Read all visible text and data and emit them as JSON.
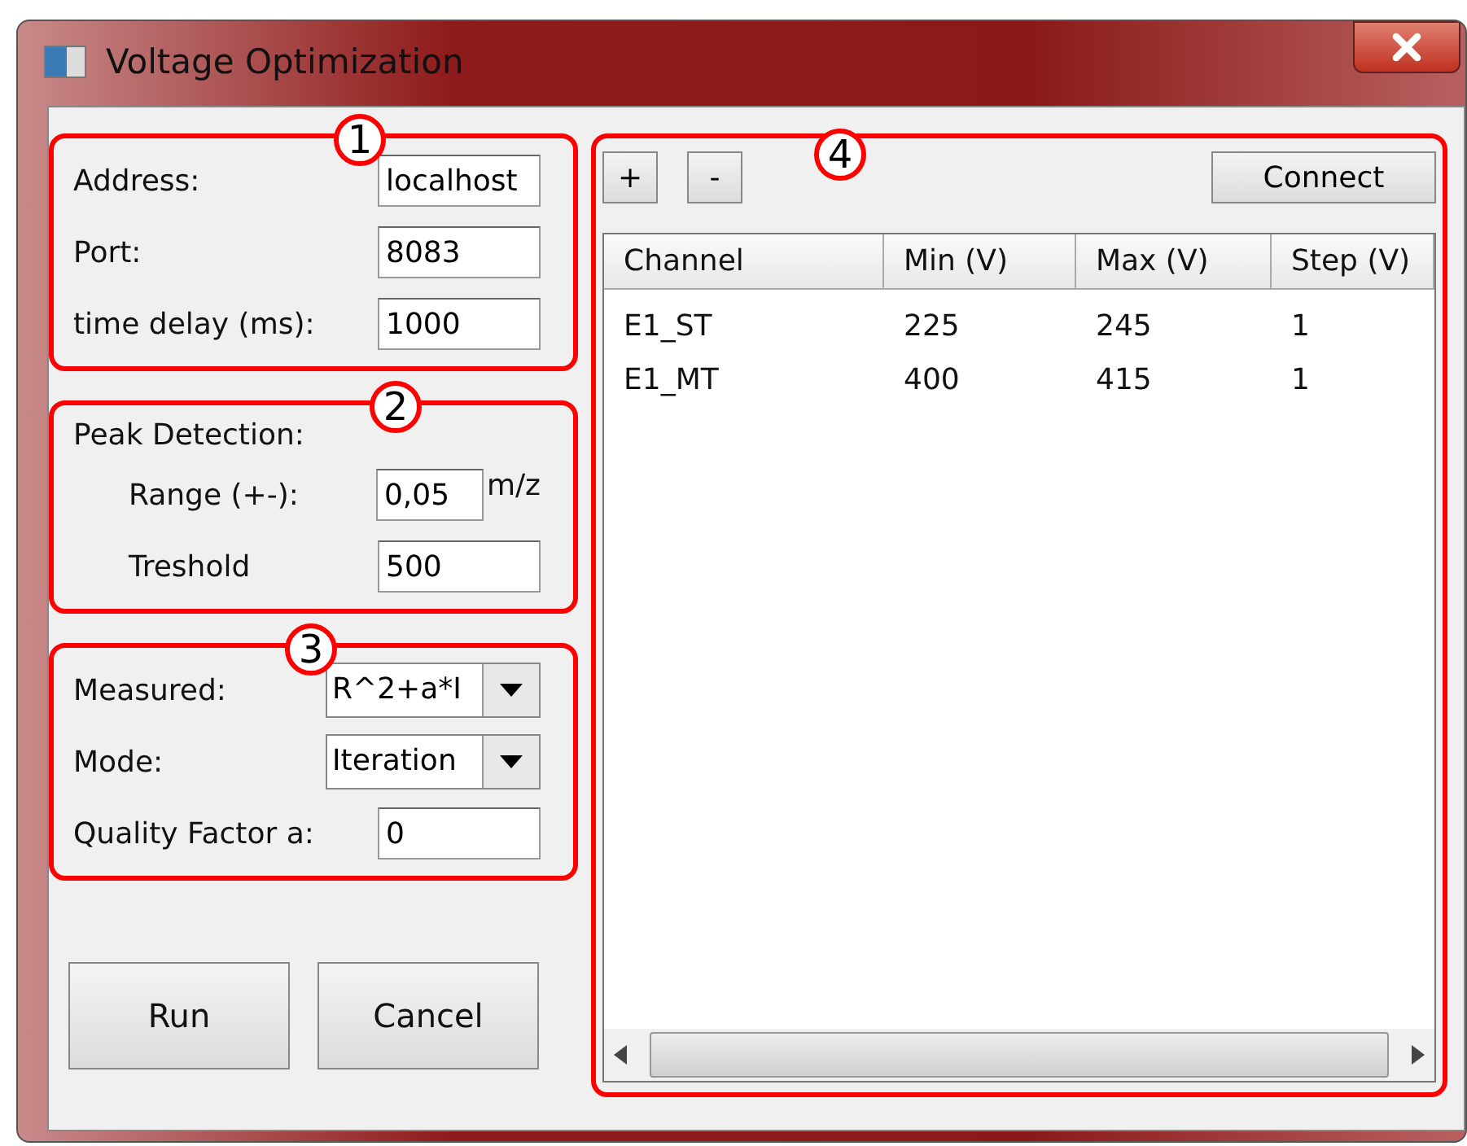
{
  "window": {
    "title": "Voltage Optimization"
  },
  "groups": [
    {
      "callout": "1",
      "fields": [
        {
          "label": "Address:",
          "value": "localhost",
          "kind": "text",
          "indent": false
        },
        {
          "label": "Port:",
          "value": "8083",
          "kind": "text",
          "indent": false
        },
        {
          "label": "time delay (ms):",
          "value": "1000",
          "kind": "text",
          "indent": false
        }
      ]
    },
    {
      "callout": "2",
      "title": "Peak Detection:",
      "fields": [
        {
          "label": "Range (+-):",
          "value": "0,05",
          "unit": "m/z",
          "kind": "text",
          "indent": true
        },
        {
          "label": "Treshold",
          "value": "500",
          "kind": "text",
          "indent": true
        }
      ]
    },
    {
      "callout": "3",
      "fields": [
        {
          "label": "Measured:",
          "value": "R^2+a*I",
          "kind": "dropdown",
          "indent": false
        },
        {
          "label": "Mode:",
          "value": "Iteration",
          "kind": "dropdown",
          "indent": false
        },
        {
          "label": "Quality Factor a:",
          "value": "0",
          "kind": "text",
          "indent": false
        }
      ]
    }
  ],
  "buttons": [
    "Run",
    "Cancel"
  ],
  "channels_panel": {
    "callout": "4",
    "tool_buttons": [
      "+",
      "-"
    ],
    "connect": "Connect",
    "table": {
      "columns": [
        "Channel",
        "Min (V)",
        "Max (V)",
        "Step (V)"
      ],
      "rows": [
        [
          "E1_ST",
          "225",
          "245",
          "1"
        ],
        [
          "E1_MT",
          "400",
          "415",
          "1"
        ]
      ]
    }
  }
}
